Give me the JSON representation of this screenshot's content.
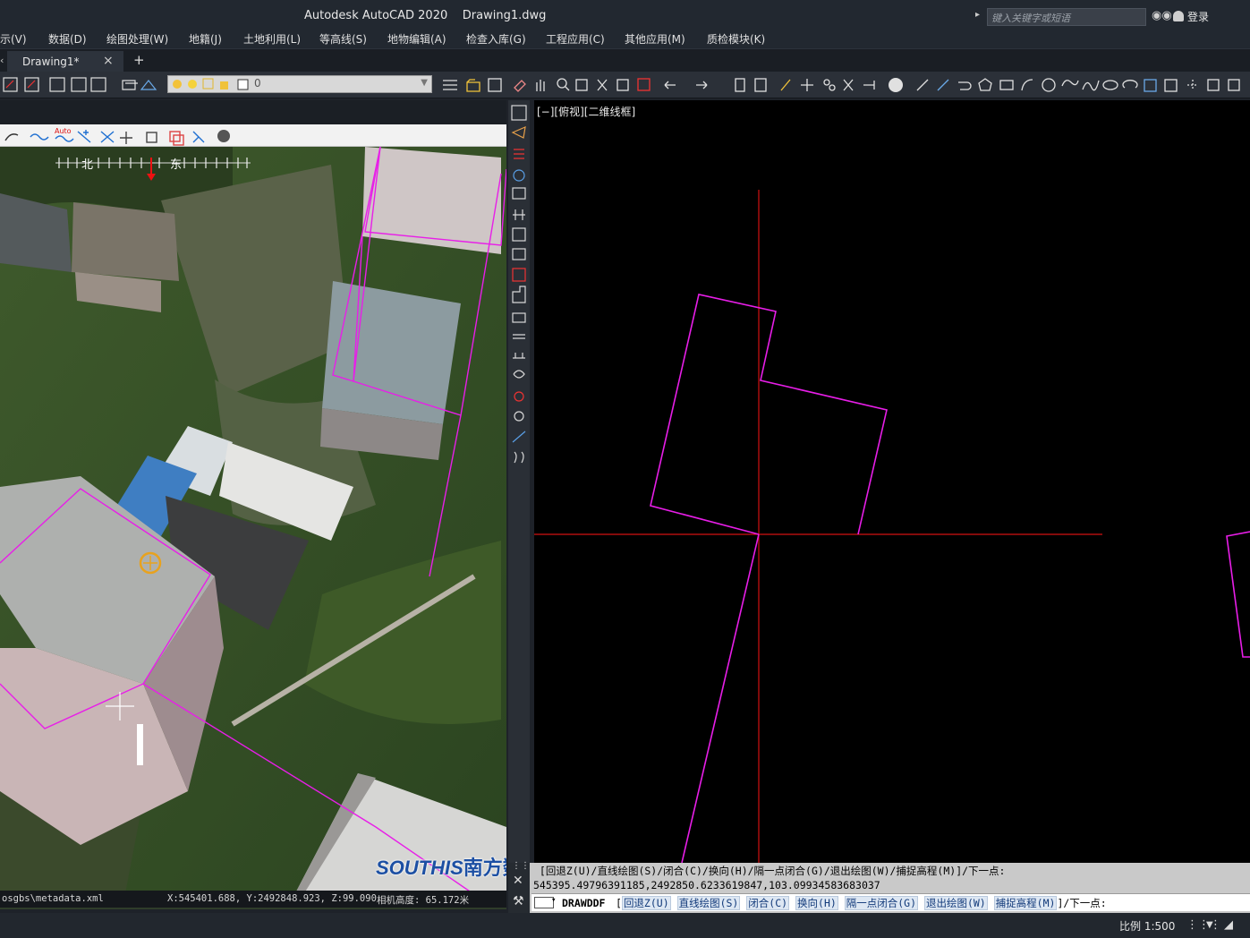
{
  "title": {
    "app": "Autodesk AutoCAD 2020",
    "file": "Drawing1.dwg",
    "search_placeholder": "键入关键字或短语",
    "login": "登录"
  },
  "menu": [
    "示(V)",
    "数据(D)",
    "绘图处理(W)",
    "地籍(J)",
    "土地利用(L)",
    "等高线(S)",
    "地物编辑(A)",
    "检查入库(G)",
    "工程应用(C)",
    "其他应用(M)",
    "质检模块(K)"
  ],
  "tabs": {
    "active": "Drawing1*",
    "close": "×",
    "new": "+"
  },
  "layer": {
    "current": "0"
  },
  "photo": {
    "compass_label_n": "北",
    "compass_label_e": "东",
    "toolbar_auto": "Auto",
    "status_file": "osgbs\\metadata.xml",
    "status_coords": "X:545401.688, Y:2492848.923, Z:99.090",
    "status_camera": "相机高度: 65.172米",
    "logo_en": "SOUTHIS",
    "logo_cn": "南方数码"
  },
  "viewport": {
    "label": "[−][俯视][二维线框]",
    "colors": {
      "outline": "#e81ee8",
      "axis": "#d21212"
    }
  },
  "cmdline": {
    "history_1": " [回退Z(U)/直线绘图(S)/闭合(C)/换向(H)/隔一点闭合(G)/退出绘图(W)/捕捉高程(M)]/下一点:",
    "history_2": "545395.49796391185,2492850.6233619847,103.09934583683037",
    "command": "DRAWDDF",
    "options": [
      "回退Z(U)",
      "直线绘图(S)",
      "闭合(C)",
      "换向(H)",
      "隔一点闭合(G)",
      "退出绘图(W)",
      "捕捉高程(M)"
    ],
    "suffix": "]/下一点:"
  },
  "status": {
    "scale": "比例 1:500"
  }
}
